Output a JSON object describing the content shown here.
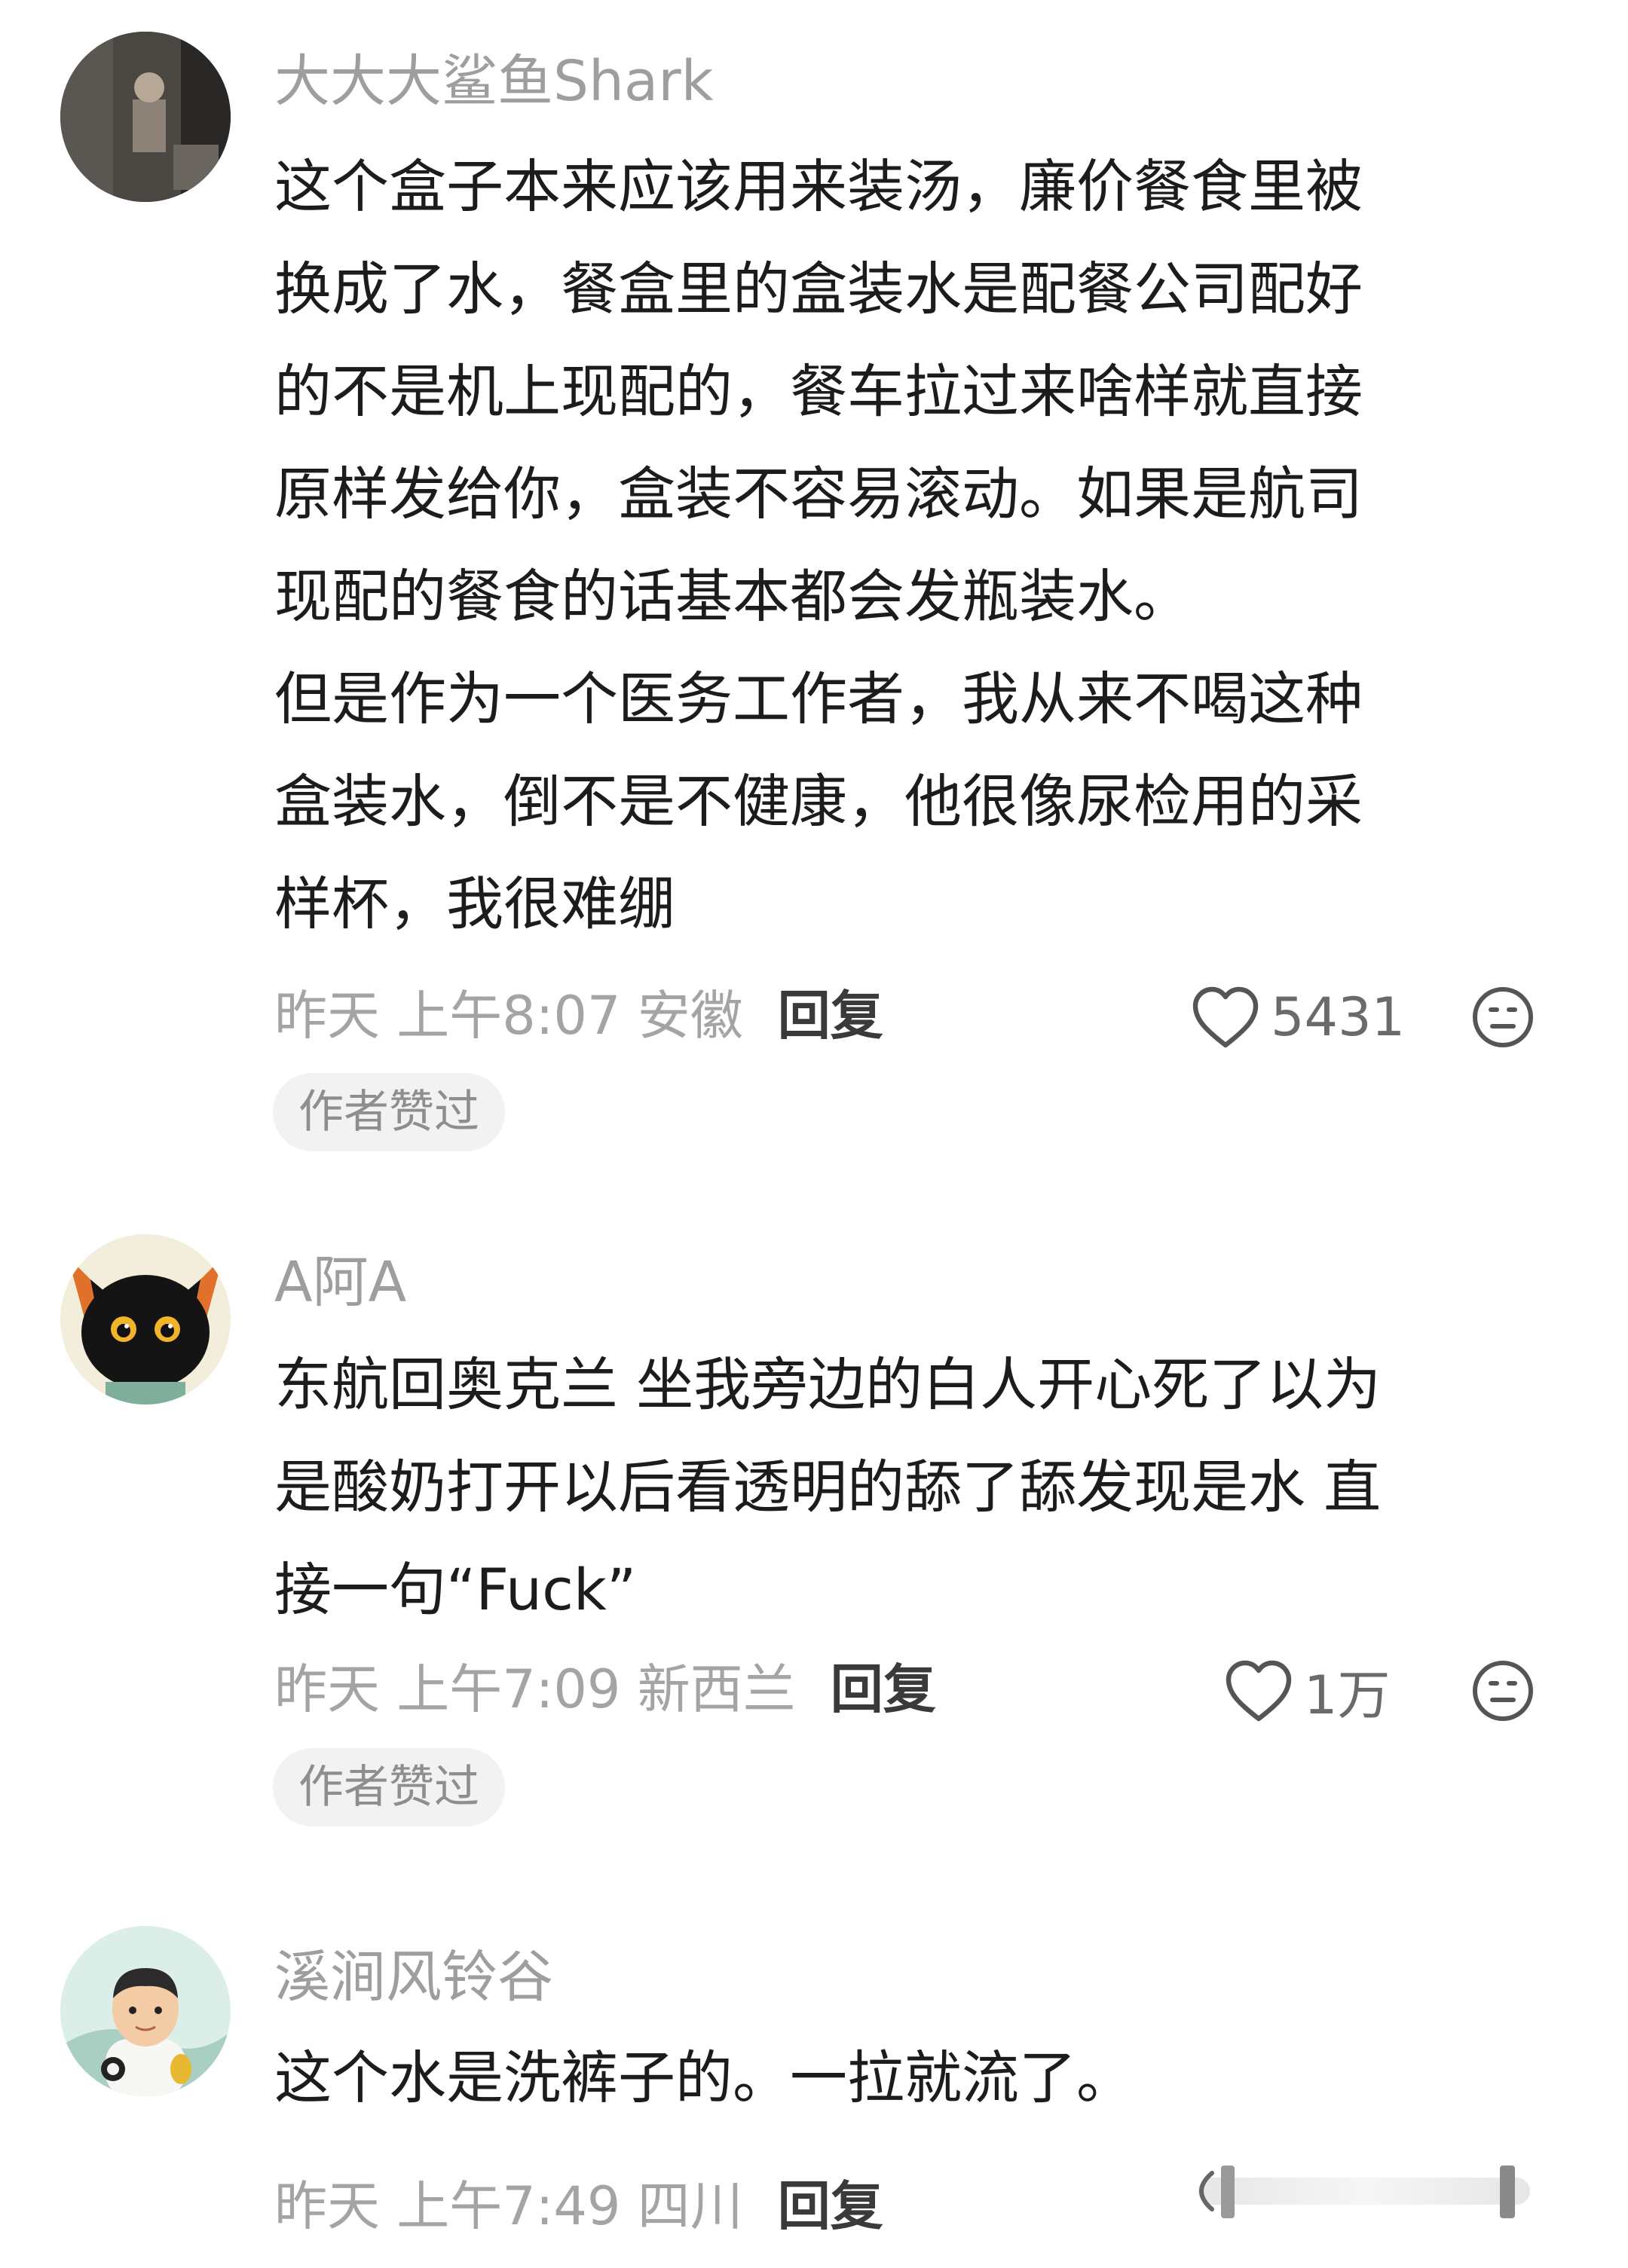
{
  "comments": [
    {
      "username": "大大大鲨鱼Shark",
      "lines": [
        "这个盒子本来应该用来装汤，廉价餐食里被",
        "换成了水，餐盒里的盒装水是配餐公司配好",
        "的不是机上现配的，餐车拉过来啥样就直接",
        "原样发给你，盒装不容易滚动。如果是航司",
        "现配的餐食的话基本都会发瓶装水。",
        "但是作为一个医务工作者，我从来不喝这种",
        "盒装水，倒不是不健康，他很像尿检用的采",
        "样杯，我很难绷"
      ],
      "time_location": "昨天 上午8:07 安徽",
      "reply_label": "回复",
      "like_count": "5431",
      "badge": "作者赞过"
    },
    {
      "username": "A阿A",
      "lines": [
        "东航回奥克兰 坐我旁边的白人开心死了以为",
        "是酸奶打开以后看透明的舔了舔发现是水 直",
        "接一句“Fuck”"
      ],
      "time_location": "昨天 上午7:09 新西兰",
      "reply_label": "回复",
      "like_count": "1万",
      "badge": "作者赞过"
    },
    {
      "username": "溪涧风铃谷",
      "lines": [
        "这个水是洗裤子的。一拉就流了。"
      ],
      "time_location": "昨天 上午7:49 四川",
      "reply_label": "回复"
    }
  ],
  "colors": {
    "username": "#9e9e9e",
    "body_text": "#1c1c1c",
    "meta": "#a4a4a4",
    "badge_bg": "#f2f2f2"
  },
  "icons": {
    "like": "heart-outline-icon",
    "dislike": "neutral-face-icon"
  }
}
